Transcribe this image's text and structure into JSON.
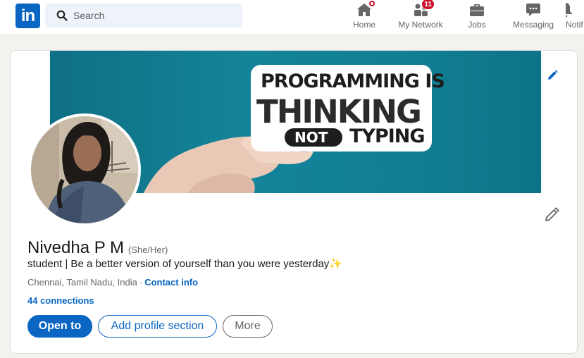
{
  "nav": {
    "logo": "in",
    "search_placeholder": "Search",
    "items": [
      {
        "label": "Home",
        "icon": "home-icon",
        "badge": ""
      },
      {
        "label": "My Network",
        "icon": "network-icon",
        "badge": "11"
      },
      {
        "label": "Jobs",
        "icon": "briefcase-icon",
        "badge": ""
      },
      {
        "label": "Messaging",
        "icon": "chat-icon",
        "badge": ""
      },
      {
        "label": "Notif",
        "icon": "bell-icon",
        "badge": ""
      }
    ]
  },
  "banner": {
    "line1": "PROGRAMMING IS",
    "line2": "THINKING",
    "line3_pill": "NOT",
    "line3": "TYPING"
  },
  "profile": {
    "name": "Nivedha P M",
    "pronouns": "(She/Her)",
    "headline": "student | Be a better version of yourself than you were yesterday✨",
    "location": "Chennai, Tamil Nadu, India",
    "separator": "·",
    "contact_info": "Contact info",
    "connections": "44 connections"
  },
  "actions": {
    "open_to": "Open to",
    "add_section": "Add profile section",
    "more": "More"
  },
  "colors": {
    "brand": "#0a66c2",
    "badge": "#cb112d",
    "banner": "#14849a"
  }
}
